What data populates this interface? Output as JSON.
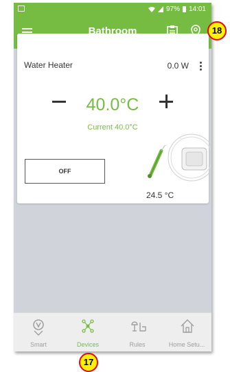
{
  "status_bar": {
    "battery_text": "97%",
    "time": "14:01"
  },
  "app_bar": {
    "title": "Bathroom"
  },
  "device": {
    "name": "Water Heater",
    "power": "0.0 W",
    "setpoint": "40.0°C",
    "current": "Current 40.0°C",
    "off_label": "OFF",
    "probe_temperature": "24.5 °C"
  },
  "bottom_nav": {
    "items": [
      {
        "label": "Smart",
        "icon": "smart-hand-icon"
      },
      {
        "label": "Devices",
        "icon": "devices-network-icon"
      },
      {
        "label": "Rules",
        "icon": "rules-icon"
      },
      {
        "label": "Home Setu...",
        "icon": "home-setup-icon"
      }
    ],
    "active": "Devices"
  },
  "annotations": {
    "badge_top": "18",
    "badge_bottom": "17"
  },
  "colors": {
    "accent": "#76bc43",
    "badge_fill": "#fff200",
    "badge_border": "#e30613"
  }
}
